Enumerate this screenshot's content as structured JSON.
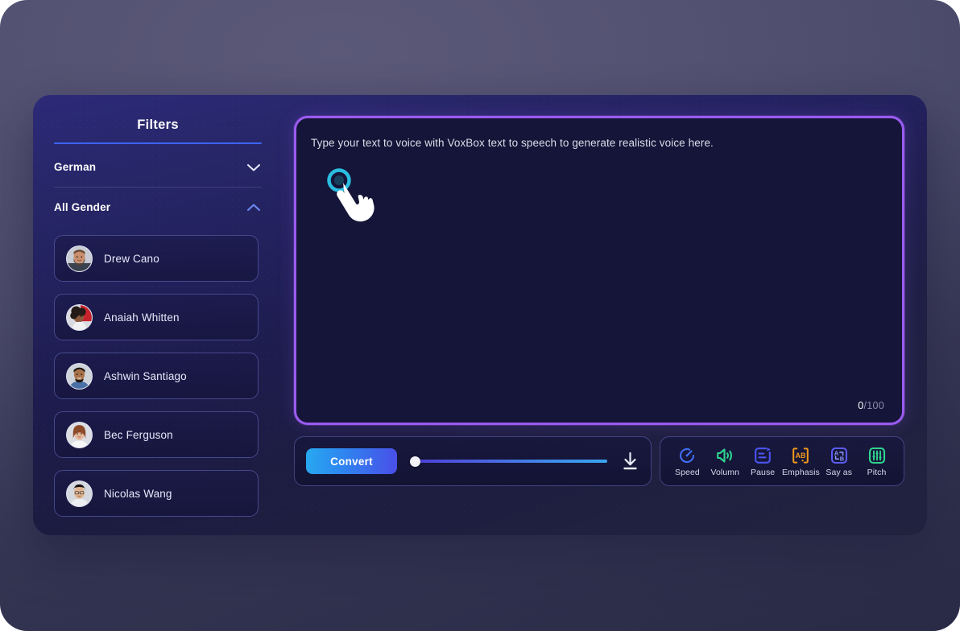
{
  "sidebar": {
    "title": "Filters",
    "language_filter": {
      "label": "German",
      "icon": "chevron-down-icon",
      "expanded": false
    },
    "gender_filter": {
      "label": "All Gender",
      "icon": "chevron-up-icon",
      "expanded": true
    },
    "voices": [
      {
        "name": "Drew Cano"
      },
      {
        "name": "Anaiah Whitten"
      },
      {
        "name": "Ashwin Santiago"
      },
      {
        "name": "Bec Ferguson"
      },
      {
        "name": "Nicolas Wang"
      }
    ]
  },
  "editor": {
    "placeholder": "Type your text to voice with VoxBox text to speech to generate realistic voice here.",
    "value": "",
    "char_current": "0",
    "char_max": "/100",
    "cursor_icon": "hand-pointer-cursor"
  },
  "bottom": {
    "convert_label": "Convert",
    "slider_value": 0,
    "download_icon": "download-icon",
    "tools": [
      {
        "label": "Speed",
        "icon": "speed-gauge-icon",
        "color": "#3f6ef2"
      },
      {
        "label": "Volumn",
        "icon": "volume-icon",
        "color": "#2fd48f"
      },
      {
        "label": "Pause",
        "icon": "pause-note-icon",
        "color": "#4b55f0"
      },
      {
        "label": "Emphasis",
        "icon": "emphasis-ab-icon",
        "color": "#f39a1b"
      },
      {
        "label": "Say as",
        "icon": "say-as-icon",
        "color": "#5b5bf2"
      },
      {
        "label": "Pitch",
        "icon": "pitch-sliders-icon",
        "color": "#2fd48f"
      }
    ]
  },
  "theme": {
    "accent_purple": "#9b5bf0",
    "accent_blue": "#3b63f2",
    "panel_bg": "#1d1c4d",
    "page_bg": "#4b4a6a"
  }
}
